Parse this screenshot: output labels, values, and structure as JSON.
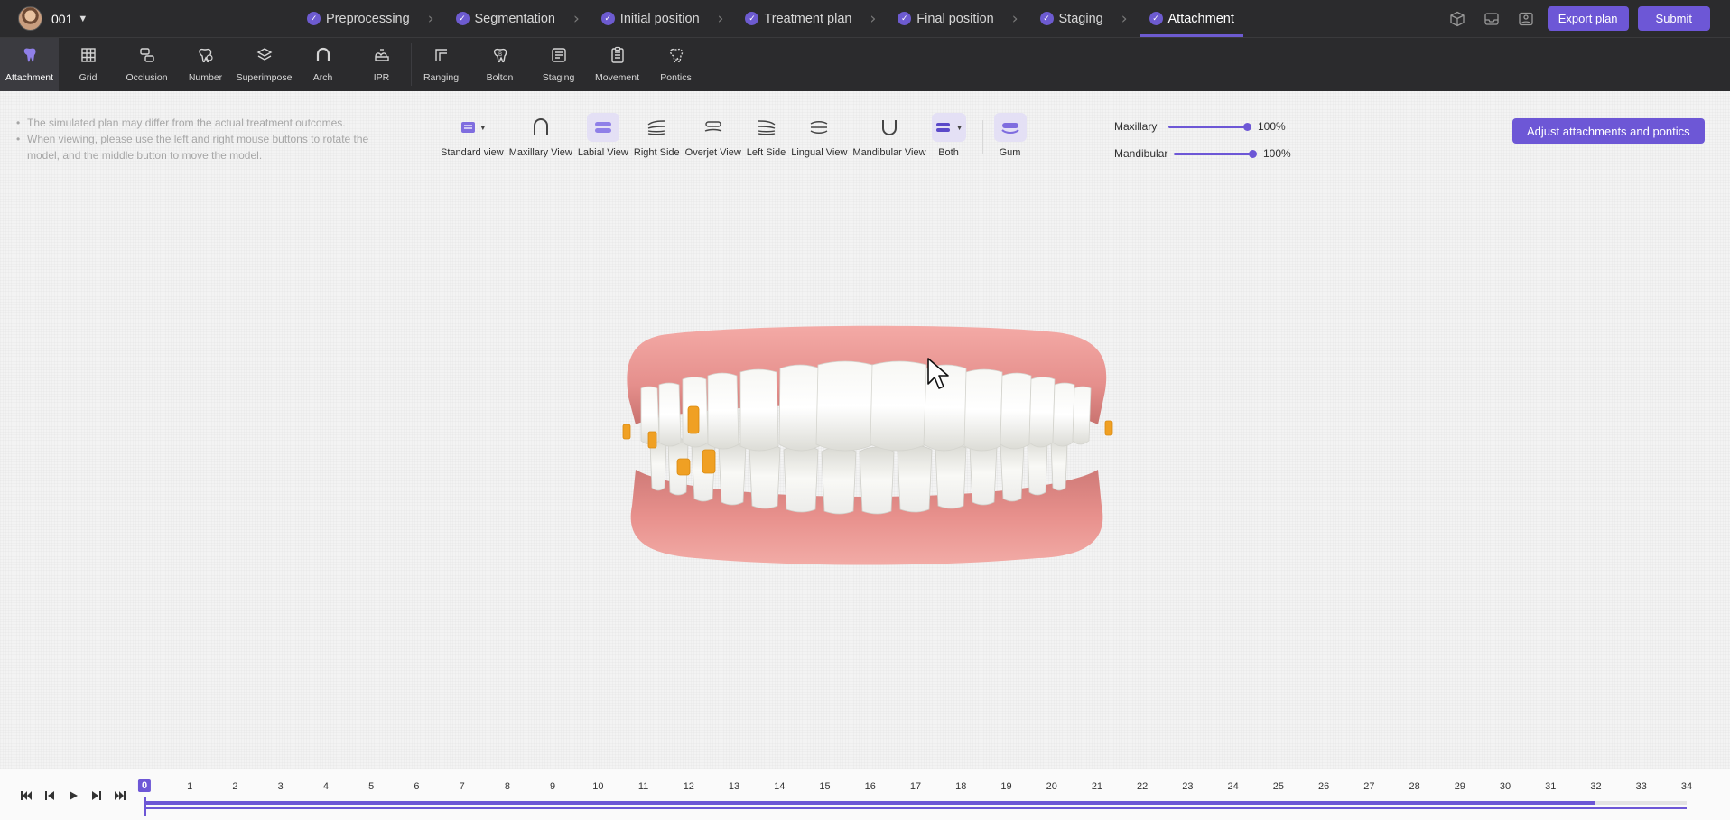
{
  "user": {
    "name": "001"
  },
  "steps": [
    {
      "label": "Preprocessing",
      "done": true
    },
    {
      "label": "Segmentation",
      "done": true
    },
    {
      "label": "Initial position",
      "done": true
    },
    {
      "label": "Treatment plan",
      "done": true
    },
    {
      "label": "Final position",
      "done": true
    },
    {
      "label": "Staging",
      "done": true
    },
    {
      "label": "Attachment",
      "done": true,
      "active": true
    }
  ],
  "header": {
    "export_label": "Export plan",
    "submit_label": "Submit"
  },
  "tools": [
    {
      "label": "Attachment",
      "icon": "tooth-icon",
      "active": true
    },
    {
      "label": "Grid",
      "icon": "grid-icon"
    },
    {
      "label": "Occlusion",
      "icon": "occlusion-icon"
    },
    {
      "label": "Number",
      "icon": "number-icon"
    },
    {
      "label": "Superimpose",
      "icon": "layers-icon"
    },
    {
      "label": "Arch",
      "icon": "arch-icon"
    },
    {
      "label": "IPR",
      "icon": "ipr-icon"
    },
    {
      "label": "Ranging",
      "icon": "ranging-icon"
    },
    {
      "label": "Bolton",
      "icon": "bolton-icon"
    },
    {
      "label": "Staging",
      "icon": "staging-icon"
    },
    {
      "label": "Movement",
      "icon": "movement-icon"
    },
    {
      "label": "Pontics",
      "icon": "pontics-icon"
    }
  ],
  "notes": [
    "The simulated plan may differ from the actual treatment outcomes.",
    "When viewing, please use the left and right mouse buttons to rotate the model, and the middle button to move the model."
  ],
  "views": [
    {
      "label": "Standard view",
      "icon": "standard-view-icon",
      "dropdown": true
    },
    {
      "label": "Maxillary View",
      "icon": "maxillary-view-icon"
    },
    {
      "label": "Labial View",
      "icon": "labial-view-icon",
      "selected": true
    },
    {
      "label": "Right Side",
      "icon": "right-side-icon"
    },
    {
      "label": "Overjet View",
      "icon": "overjet-view-icon"
    },
    {
      "label": "Left Side",
      "icon": "left-side-icon"
    },
    {
      "label": "Lingual View",
      "icon": "lingual-view-icon"
    },
    {
      "label": "Mandibular View",
      "icon": "mandibular-view-icon"
    },
    {
      "label": "Both",
      "icon": "both-jaws-icon",
      "dropdown": true,
      "selected": true
    },
    {
      "label": "Gum",
      "icon": "gum-icon",
      "selected": true
    }
  ],
  "opacity": {
    "maxillary": {
      "label": "Maxillary",
      "value": "100%",
      "fraction": 1.0
    },
    "mandibular": {
      "label": "Mandibular",
      "value": "100%",
      "fraction": 1.0
    }
  },
  "adjust_label": "Adjust attachments and pontics",
  "timeline": {
    "current": 0,
    "progress_fraction": 0.94,
    "stages": [
      "0",
      "1",
      "2",
      "3",
      "4",
      "5",
      "6",
      "7",
      "8",
      "9",
      "10",
      "11",
      "12",
      "13",
      "14",
      "15",
      "16",
      "17",
      "18",
      "19",
      "20",
      "21",
      "22",
      "23",
      "24",
      "25",
      "26",
      "27",
      "28",
      "29",
      "30",
      "31",
      "32",
      "33",
      "34"
    ]
  },
  "colors": {
    "accent": "#6d57d6",
    "topbar": "#2b2b2d",
    "attachment": "#f0a023",
    "gum": "#e58f8c"
  }
}
